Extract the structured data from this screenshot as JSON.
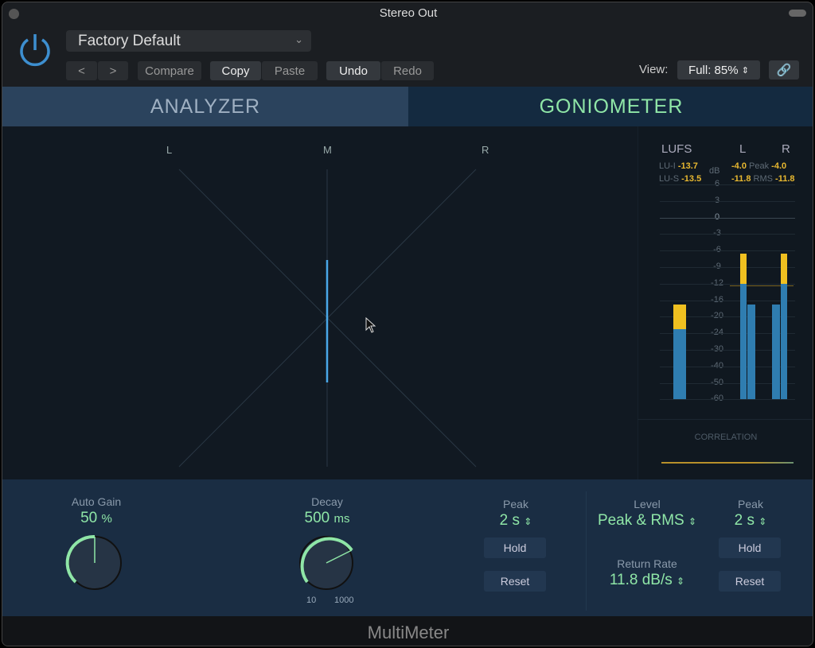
{
  "window": {
    "title": "Stereo Out"
  },
  "header": {
    "preset": "Factory Default",
    "prev": "<",
    "next": ">",
    "compare": "Compare",
    "copy": "Copy",
    "paste": "Paste",
    "undo": "Undo",
    "redo": "Redo",
    "view_label": "View:",
    "view_value": "Full: 85%"
  },
  "tabs": [
    {
      "label": "ANALYZER",
      "active": false
    },
    {
      "label": "GONIOMETER",
      "active": true
    }
  ],
  "goniometer": {
    "labels": [
      "L",
      "M",
      "R"
    ]
  },
  "meters": {
    "lufs_title": "LUFS",
    "l_title": "L",
    "r_title": "R",
    "db_unit": "dB",
    "lu_i_label": "LU-I",
    "lu_i": "-13.7",
    "lu_s_label": "LU-S",
    "lu_s": "-13.5",
    "peak_label": "Peak",
    "l_peak": "-4.0",
    "r_peak": "-4.0",
    "rms_label": "RMS",
    "l_rms": "-11.8",
    "r_rms": "-11.8",
    "scale": [
      "6",
      "3",
      "0",
      "-3",
      "-6",
      "-9",
      "-12",
      "-16",
      "-20",
      "-24",
      "-30",
      "-40",
      "-50",
      "-60"
    ],
    "levels_db": {
      "lufs_peak": -17,
      "lufs": -23,
      "l_peak": -6.5,
      "l_rms": -12,
      "l_rms2": -17,
      "r_rms2": -17,
      "r_peak": -6.5,
      "r_rms": -12
    },
    "correlation_label": "CORRELATION",
    "colors": {
      "bar": "#2f7db0",
      "peak": "#f0c020"
    }
  },
  "controls": {
    "auto_gain_label": "Auto Gain",
    "auto_gain_value": "50",
    "auto_gain_unit": "%",
    "decay_label": "Decay",
    "decay_value": "500",
    "decay_unit": "ms",
    "decay_min": "10",
    "decay_max": "1000",
    "peak_label": "Peak",
    "peak_value": "2 s",
    "hold": "Hold",
    "reset": "Reset",
    "level_label": "Level",
    "level_value": "Peak & RMS",
    "return_rate_label": "Return Rate",
    "return_rate_value": "11.8 dB/s",
    "peak2_label": "Peak",
    "peak2_value": "2 s",
    "hold2": "Hold",
    "reset2": "Reset"
  },
  "footer": {
    "title": "MultiMeter"
  },
  "accent": "#8fe6a7"
}
